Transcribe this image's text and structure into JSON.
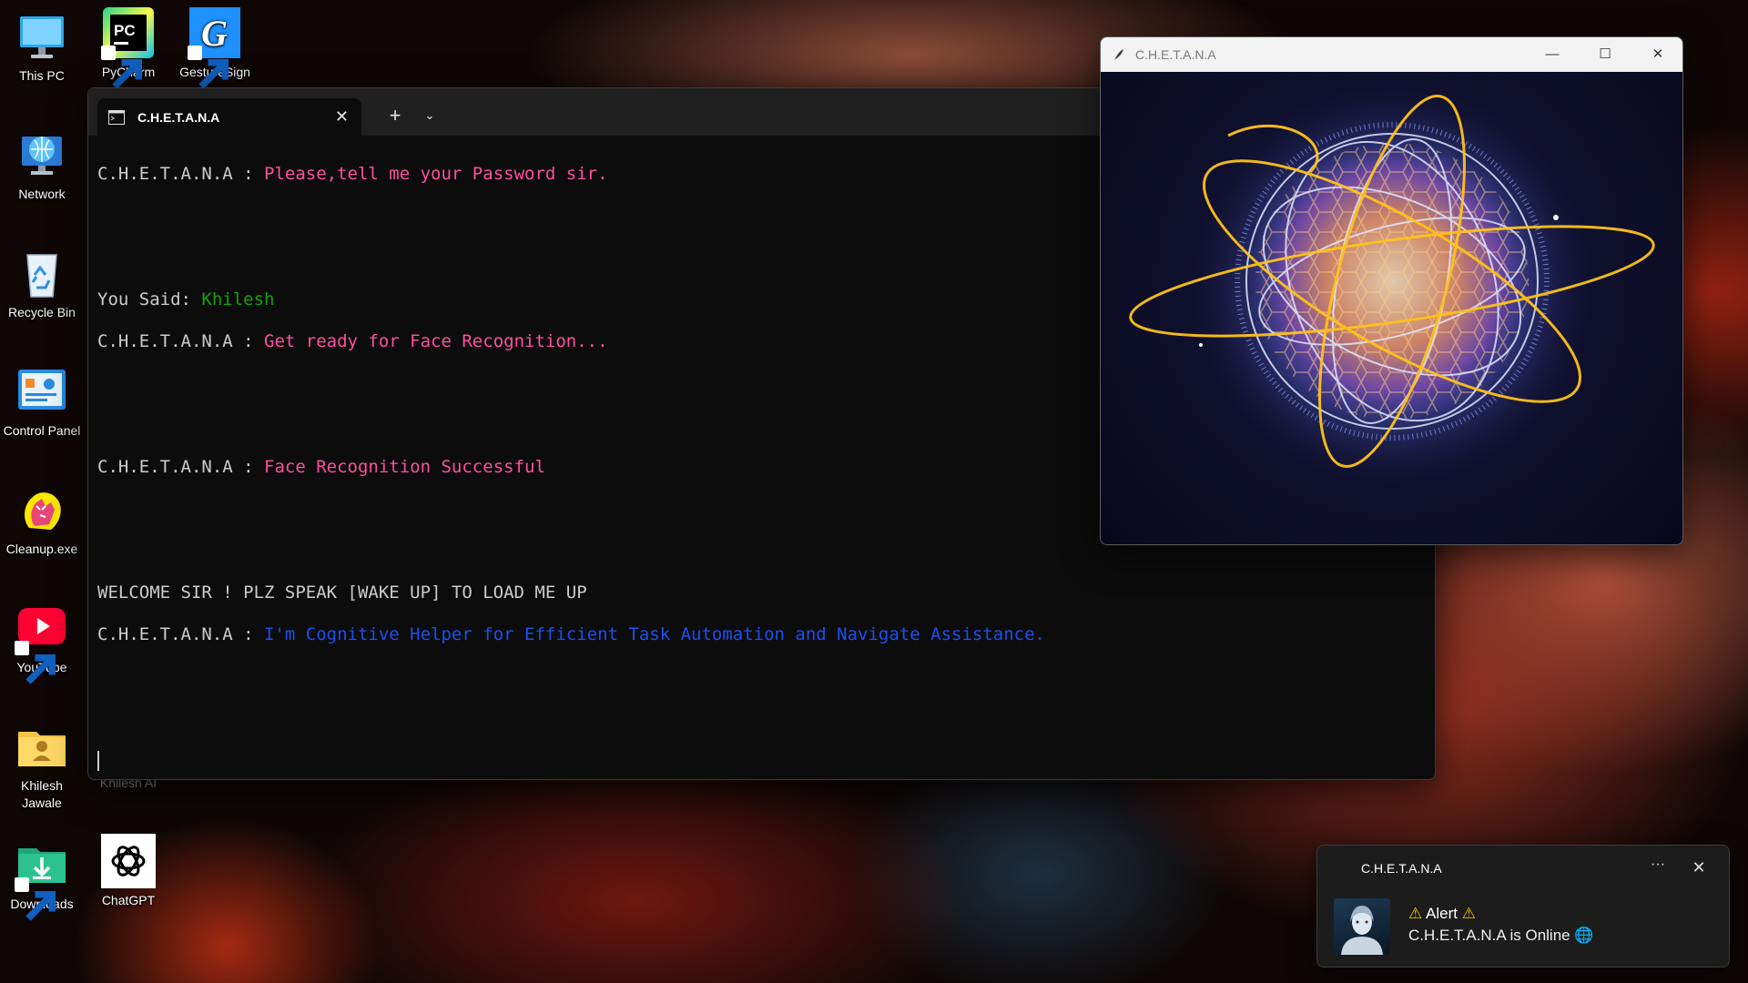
{
  "desktop": {
    "icons": [
      {
        "label": "This PC",
        "icon": "monitor-icon"
      },
      {
        "label": "PyCharm",
        "icon": "pycharm-icon"
      },
      {
        "label": "GestureSign",
        "icon": "gesturesign-icon"
      },
      {
        "label": "Network",
        "icon": "network-globe-icon"
      },
      {
        "label": "Recycle Bin",
        "icon": "recycle-bin-icon"
      },
      {
        "label": "Control Panel",
        "icon": "control-panel-icon"
      },
      {
        "label": "Cleanup.exe",
        "icon": "cleanup-hand-icon"
      },
      {
        "label": "YouTube",
        "icon": "youtube-icon"
      },
      {
        "label": "Khilesh Jawale",
        "icon": "user-folder-icon"
      },
      {
        "label": "Khilesh AI",
        "icon": "hidden"
      },
      {
        "label": "Downloads",
        "icon": "downloads-folder-icon"
      },
      {
        "label": "ChatGPT",
        "icon": "chatgpt-icon"
      }
    ]
  },
  "terminal": {
    "tab_title": "C.H.E.T.A.N.A",
    "tab_close": "✕",
    "new_tab": "+",
    "dropdown": "⌄",
    "lines": [
      {
        "prefix": "C.H.E.T.A.N.A : ",
        "text": "Please,tell me your Password sir.",
        "color": "pink"
      },
      {
        "prefix": "",
        "text": "",
        "color": "none"
      },
      {
        "prefix": "",
        "text": "",
        "color": "none"
      },
      {
        "prefix": "You Said: ",
        "text": "Khilesh",
        "color": "green"
      },
      {
        "prefix": "C.H.E.T.A.N.A : ",
        "text": "Get ready for Face Recognition...",
        "color": "pink"
      },
      {
        "prefix": "",
        "text": "",
        "color": "none"
      },
      {
        "prefix": "",
        "text": "",
        "color": "none"
      },
      {
        "prefix": "C.H.E.T.A.N.A : ",
        "text": "Face Recognition Successful",
        "color": "pink"
      },
      {
        "prefix": "",
        "text": "",
        "color": "none"
      },
      {
        "prefix": "",
        "text": "",
        "color": "none"
      },
      {
        "prefix": "WELCOME SIR ! PLZ SPEAK [WAKE UP] TO LOAD ME UP",
        "text": "",
        "color": "none"
      },
      {
        "prefix": "C.H.E.T.A.N.A : ",
        "text": "I'm Cognitive Helper for Efficient Task Automation and Navigate Assistance.",
        "color": "blue"
      }
    ],
    "colors": {
      "pink": "#ff4fa0",
      "green": "#13a10e",
      "blue": "#1d4ff0",
      "default": "#cccccc",
      "background": "#0c0c0c"
    }
  },
  "orb_window": {
    "title": "C.H.E.T.A.N.A",
    "minimize": "—",
    "maximize": "☐",
    "close": "✕"
  },
  "notification": {
    "app_name": "C.H.E.T.A.N.A",
    "more": "···",
    "close": "✕",
    "title_warn_left": "⚠",
    "title": "Alert",
    "title_warn_right": "⚠",
    "body": "C.H.E.T.A.N.A is Online",
    "body_icon": "🌐"
  }
}
